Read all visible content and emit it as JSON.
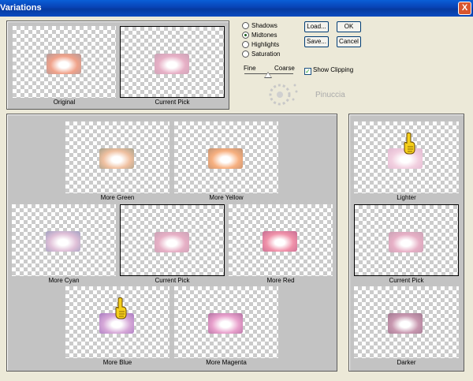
{
  "window": {
    "title": "Variations",
    "close_glyph": "X"
  },
  "options": {
    "range": [
      {
        "label": "Shadows",
        "selected": false
      },
      {
        "label": "Midtones",
        "selected": true
      },
      {
        "label": "Highlights",
        "selected": false
      },
      {
        "label": "Saturation",
        "selected": false
      }
    ],
    "fine_label": "Fine",
    "coarse_label": "Coarse",
    "show_clipping_label": "Show Clipping",
    "show_clipping_checked": true
  },
  "buttons": {
    "load": "Load...",
    "ok": "OK",
    "save": "Save...",
    "cancel": "Cancel"
  },
  "watermark": "Pinuccia",
  "top_tiles": {
    "original": "Original",
    "current_pick": "Current Pick"
  },
  "hue_tiles": {
    "more_green": "More Green",
    "more_yellow": "More Yellow",
    "more_cyan": "More Cyan",
    "current_pick": "Current Pick",
    "more_red": "More Red",
    "more_blue": "More Blue",
    "more_magenta": "More Magenta"
  },
  "light_tiles": {
    "lighter": "Lighter",
    "current_pick": "Current Pick",
    "darker": "Darker"
  },
  "icons": {
    "pointer": "pointing-hand-icon",
    "watermark": "gear-sparkle-icon"
  }
}
